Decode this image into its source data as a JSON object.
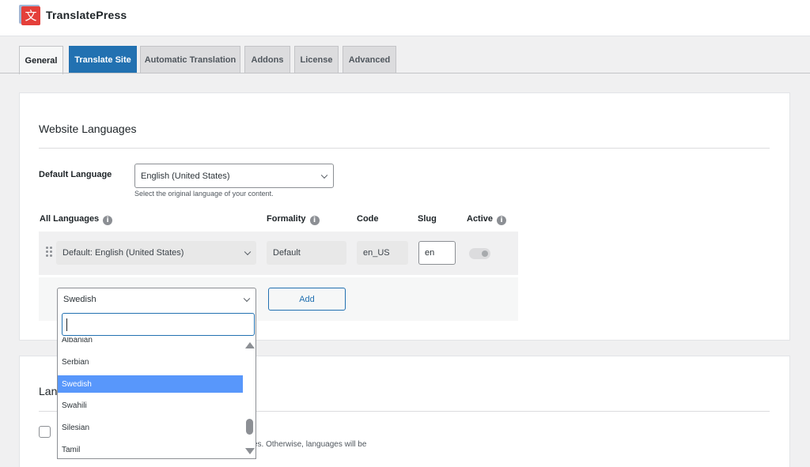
{
  "app": {
    "title": "TranslatePress",
    "logo_glyph": "文"
  },
  "tabs": [
    {
      "label": "General"
    },
    {
      "label": "Translate Site"
    },
    {
      "label": "Automatic Translation"
    },
    {
      "label": "Addons"
    },
    {
      "label": "License"
    },
    {
      "label": "Advanced"
    }
  ],
  "website_languages": {
    "heading": "Website Languages",
    "default_language": {
      "label": "Default Language",
      "value": "English (United States)",
      "help": "Select the original language of your content."
    },
    "columns": {
      "all_languages": "All Languages",
      "formality": "Formality",
      "code": "Code",
      "slug": "Slug",
      "active": "Active"
    },
    "rows": [
      {
        "language": "Default: English (United States)",
        "formality": "Default",
        "code": "en_US",
        "slug": "en",
        "active": true
      }
    ],
    "add_row": {
      "selected": "Swedish",
      "add_button": "Add",
      "search_value": "",
      "options": [
        "Albanian",
        "Serbian",
        "Swedish",
        "Swahili",
        "Silesian",
        "Tamil"
      ],
      "highlighted": "Swedish"
    }
  },
  "second_card": {
    "heading_partial": "Lan",
    "description_partial": "es. Otherwise, languages will be"
  },
  "colors": {
    "accent": "#2271b1",
    "highlight": "#5897fb",
    "logo_red": "#e43f3a"
  }
}
